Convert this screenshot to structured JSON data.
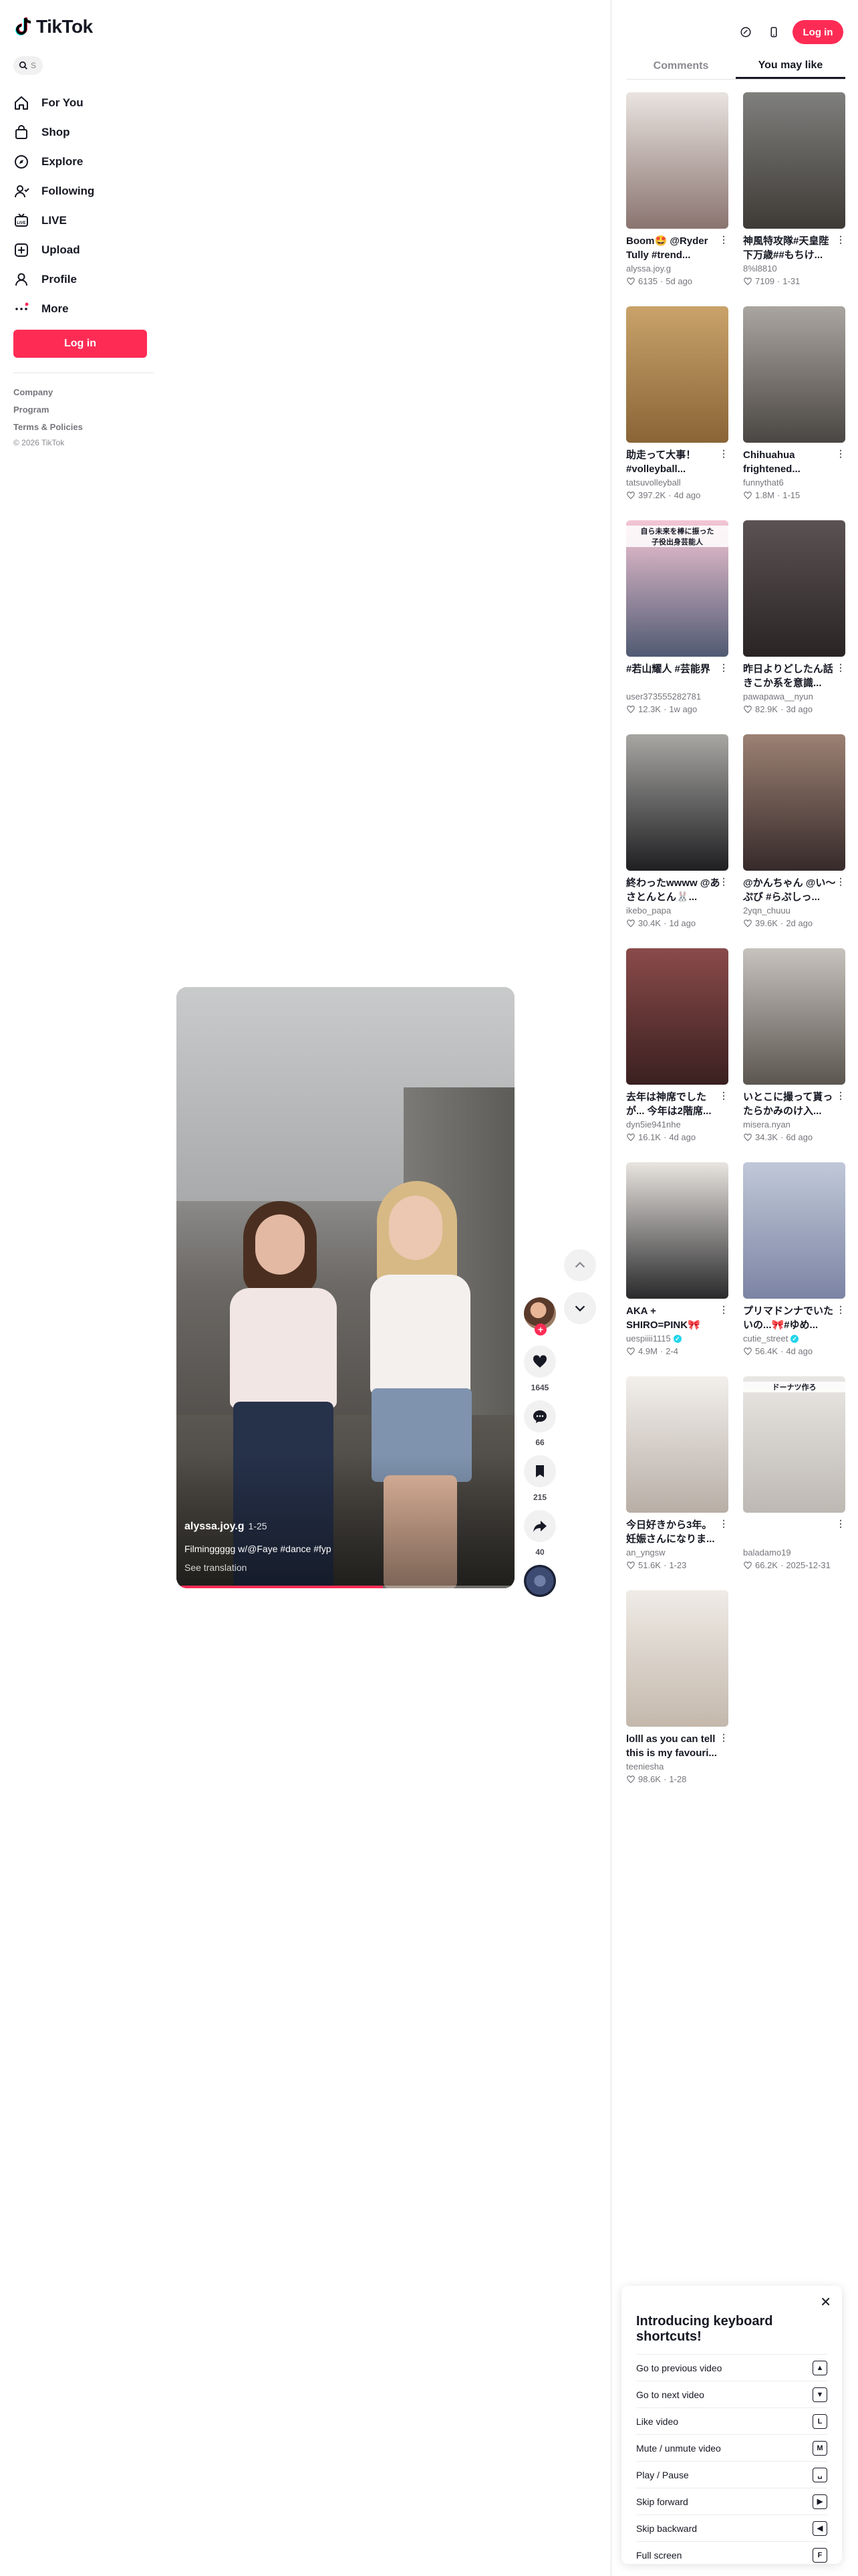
{
  "brand": {
    "name": "TikTok",
    "accent": "#fe2c55"
  },
  "search": {
    "hint": "S"
  },
  "nav": {
    "items": [
      {
        "label": "For You",
        "icon": "home-icon"
      },
      {
        "label": "Shop",
        "icon": "shop-icon"
      },
      {
        "label": "Explore",
        "icon": "compass-icon"
      },
      {
        "label": "Following",
        "icon": "following-icon"
      },
      {
        "label": "LIVE",
        "icon": "live-icon"
      },
      {
        "label": "Upload",
        "icon": "upload-icon"
      },
      {
        "label": "Profile",
        "icon": "profile-icon"
      },
      {
        "label": "More",
        "icon": "more-icon"
      }
    ],
    "login": "Log in"
  },
  "footer": {
    "links": [
      "Company",
      "Program",
      "Terms & Policies"
    ],
    "copyright": "© 2026 TikTok"
  },
  "video": {
    "author": "alyssa.joy.g",
    "date": "1-25",
    "caption": "Filminggggg w/@Faye #dance #fyp",
    "translate": "See translation",
    "progress": 0.61
  },
  "actions": {
    "likes": "1645",
    "comments": "66",
    "saves": "215",
    "shares": "40"
  },
  "header": {
    "login": "Log in"
  },
  "panel": {
    "tabs": [
      "Comments",
      "You may like"
    ],
    "active_tab": 1,
    "cards": [
      {
        "title": "Boom🤩 @Ryder Tully #trend...",
        "author": "alyssa.joy.g",
        "likes": "6135",
        "date": "5d ago",
        "verified": false,
        "thumb": [
          "#e9e4e0",
          "#8a7470"
        ],
        "label": ""
      },
      {
        "title": "神風特攻隊#天皇陛下万歳##もちけ...",
        "author": "8%l8810",
        "likes": "7109",
        "date": "1-31",
        "verified": false,
        "thumb": [
          "#7f7f7d",
          "#3e3a36"
        ],
        "label": ""
      },
      {
        "title": "助走って大事！ #volleyball...",
        "author": "tatsuvolleyball",
        "likes": "397.2K",
        "date": "4d ago",
        "verified": false,
        "thumb": [
          "#c9a36a",
          "#8a6436"
        ],
        "label": ""
      },
      {
        "title": "Chihuahua frightened...",
        "author": "funnythat6",
        "likes": "1.8M",
        "date": "1-15",
        "verified": false,
        "thumb": [
          "#aaa5a0",
          "#4a4643"
        ],
        "label": ""
      },
      {
        "title": "#若山耀人 #芸能界",
        "author": "user373555282781",
        "likes": "12.3K",
        "date": "1w ago",
        "verified": false,
        "thumb": [
          "#f4c6d6",
          "#4f5a72"
        ],
        "label": "自ら未来を棒に振った\n子役出身芸能人"
      },
      {
        "title": "昨日よりどしたん話きこか系を意識...",
        "author": "pawapawa__nyun",
        "likes": "82.9K",
        "date": "3d ago",
        "verified": false,
        "thumb": [
          "#5b5353",
          "#2a2424"
        ],
        "label": ""
      },
      {
        "title": "終わったwwww @あさとんとん🐰...",
        "author": "ikebo_papa",
        "likes": "30.4K",
        "date": "1d ago",
        "verified": false,
        "thumb": [
          "#a7a6a3",
          "#1f1f22"
        ],
        "label": ""
      },
      {
        "title": "@かんちゃん @い～ぷび #らぷしっ...",
        "author": "2yqn_chuuu",
        "likes": "39.6K",
        "date": "2d ago",
        "verified": false,
        "thumb": [
          "#9c8173",
          "#362a2a"
        ],
        "label": ""
      },
      {
        "title": "去年は神席でしたが... 今年は2階席...",
        "author": "dyn5ie941nhe",
        "likes": "16.1K",
        "date": "4d ago",
        "verified": false,
        "thumb": [
          "#8a4a4a",
          "#3a2020"
        ],
        "label": ""
      },
      {
        "title": "いとこに撮って貰ったらかみのけ入...",
        "author": "misera.nyan",
        "likes": "34.3K",
        "date": "6d ago",
        "verified": false,
        "thumb": [
          "#c7c2bd",
          "#5c5650"
        ],
        "label": ""
      },
      {
        "title": "AKA + SHIRO=PINK🎀#tr...",
        "author": "uespiiii1115",
        "likes": "4.9M",
        "date": "2-4",
        "verified": true,
        "thumb": [
          "#e8e4e0",
          "#2a2a2c"
        ],
        "label": ""
      },
      {
        "title": "プリマドンナでいたいの...🎀#ゆめ...",
        "author": "cutie_street",
        "likes": "56.4K",
        "date": "4d ago",
        "verified": true,
        "thumb": [
          "#c0c8d8",
          "#7c84a4"
        ],
        "label": ""
      },
      {
        "title": "今日好きから3年。妊娠さんになりま...",
        "author": "an_yngsw",
        "likes": "51.6K",
        "date": "1-23",
        "verified": false,
        "thumb": [
          "#f2efec",
          "#b8aea6"
        ],
        "label": ""
      },
      {
        "title": "",
        "author": "baladamo19",
        "likes": "66.2K",
        "date": "2025-12-31",
        "verified": false,
        "thumb": [
          "#e9e7e4",
          "#bdb8b2"
        ],
        "label": "ドーナツ作ろ"
      },
      {
        "title": "lolll as you can tell this is my favouri...",
        "author": "teeniesha",
        "likes": "98.6K",
        "date": "1-28",
        "verified": false,
        "thumb": [
          "#efebe6",
          "#c4b8ac"
        ],
        "label": ""
      }
    ]
  },
  "shortcuts": {
    "title": "Introducing keyboard shortcuts!",
    "rows": [
      {
        "label": "Go to previous video",
        "key": "▲"
      },
      {
        "label": "Go to next video",
        "key": "▼"
      },
      {
        "label": "Like video",
        "key": "L"
      },
      {
        "label": "Mute / unmute video",
        "key": "M"
      },
      {
        "label": "Play / Pause",
        "key": "␣"
      },
      {
        "label": "Skip forward",
        "key": "▶"
      },
      {
        "label": "Skip backward",
        "key": "◀"
      },
      {
        "label": "Full screen",
        "key": "F"
      }
    ]
  }
}
